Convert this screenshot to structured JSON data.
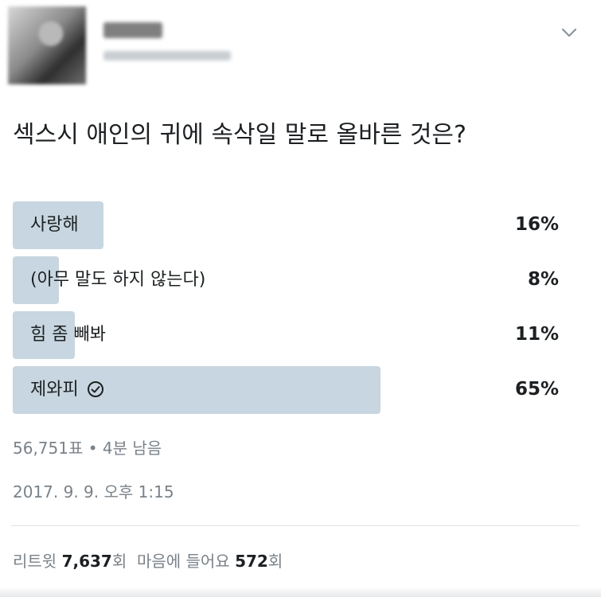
{
  "tweet": {
    "question": "섹스시 애인의 귀에 속삭일 말로 올바른 것은?"
  },
  "poll": {
    "options": [
      {
        "label": "사랑해",
        "percent_text": "16%",
        "percent": 16
      },
      {
        "label": "(아무 말도 하지 않는다)",
        "percent_text": "8%",
        "percent": 8
      },
      {
        "label": "힘 좀 빼봐",
        "percent_text": "11%",
        "percent": 11
      },
      {
        "label": "제와피",
        "percent_text": "65%",
        "percent": 65,
        "selected": true
      }
    ],
    "votes_text": "56,751표",
    "separator": "•",
    "time_left": "4분 남음"
  },
  "timestamp": "2017. 9. 9. 오후 1:15",
  "stats": {
    "retweets_label": "리트윗",
    "retweets_count": "7,637",
    "retweets_unit": "회",
    "likes_label": "마음에 들어요",
    "likes_count": "572",
    "likes_unit": "회"
  },
  "icons": {
    "menu": "chevron-down-icon",
    "selected": "check-circle-icon"
  },
  "colors": {
    "bar": "#c7d6e0",
    "text": "#1c2022",
    "secondary": "#7a8289"
  }
}
